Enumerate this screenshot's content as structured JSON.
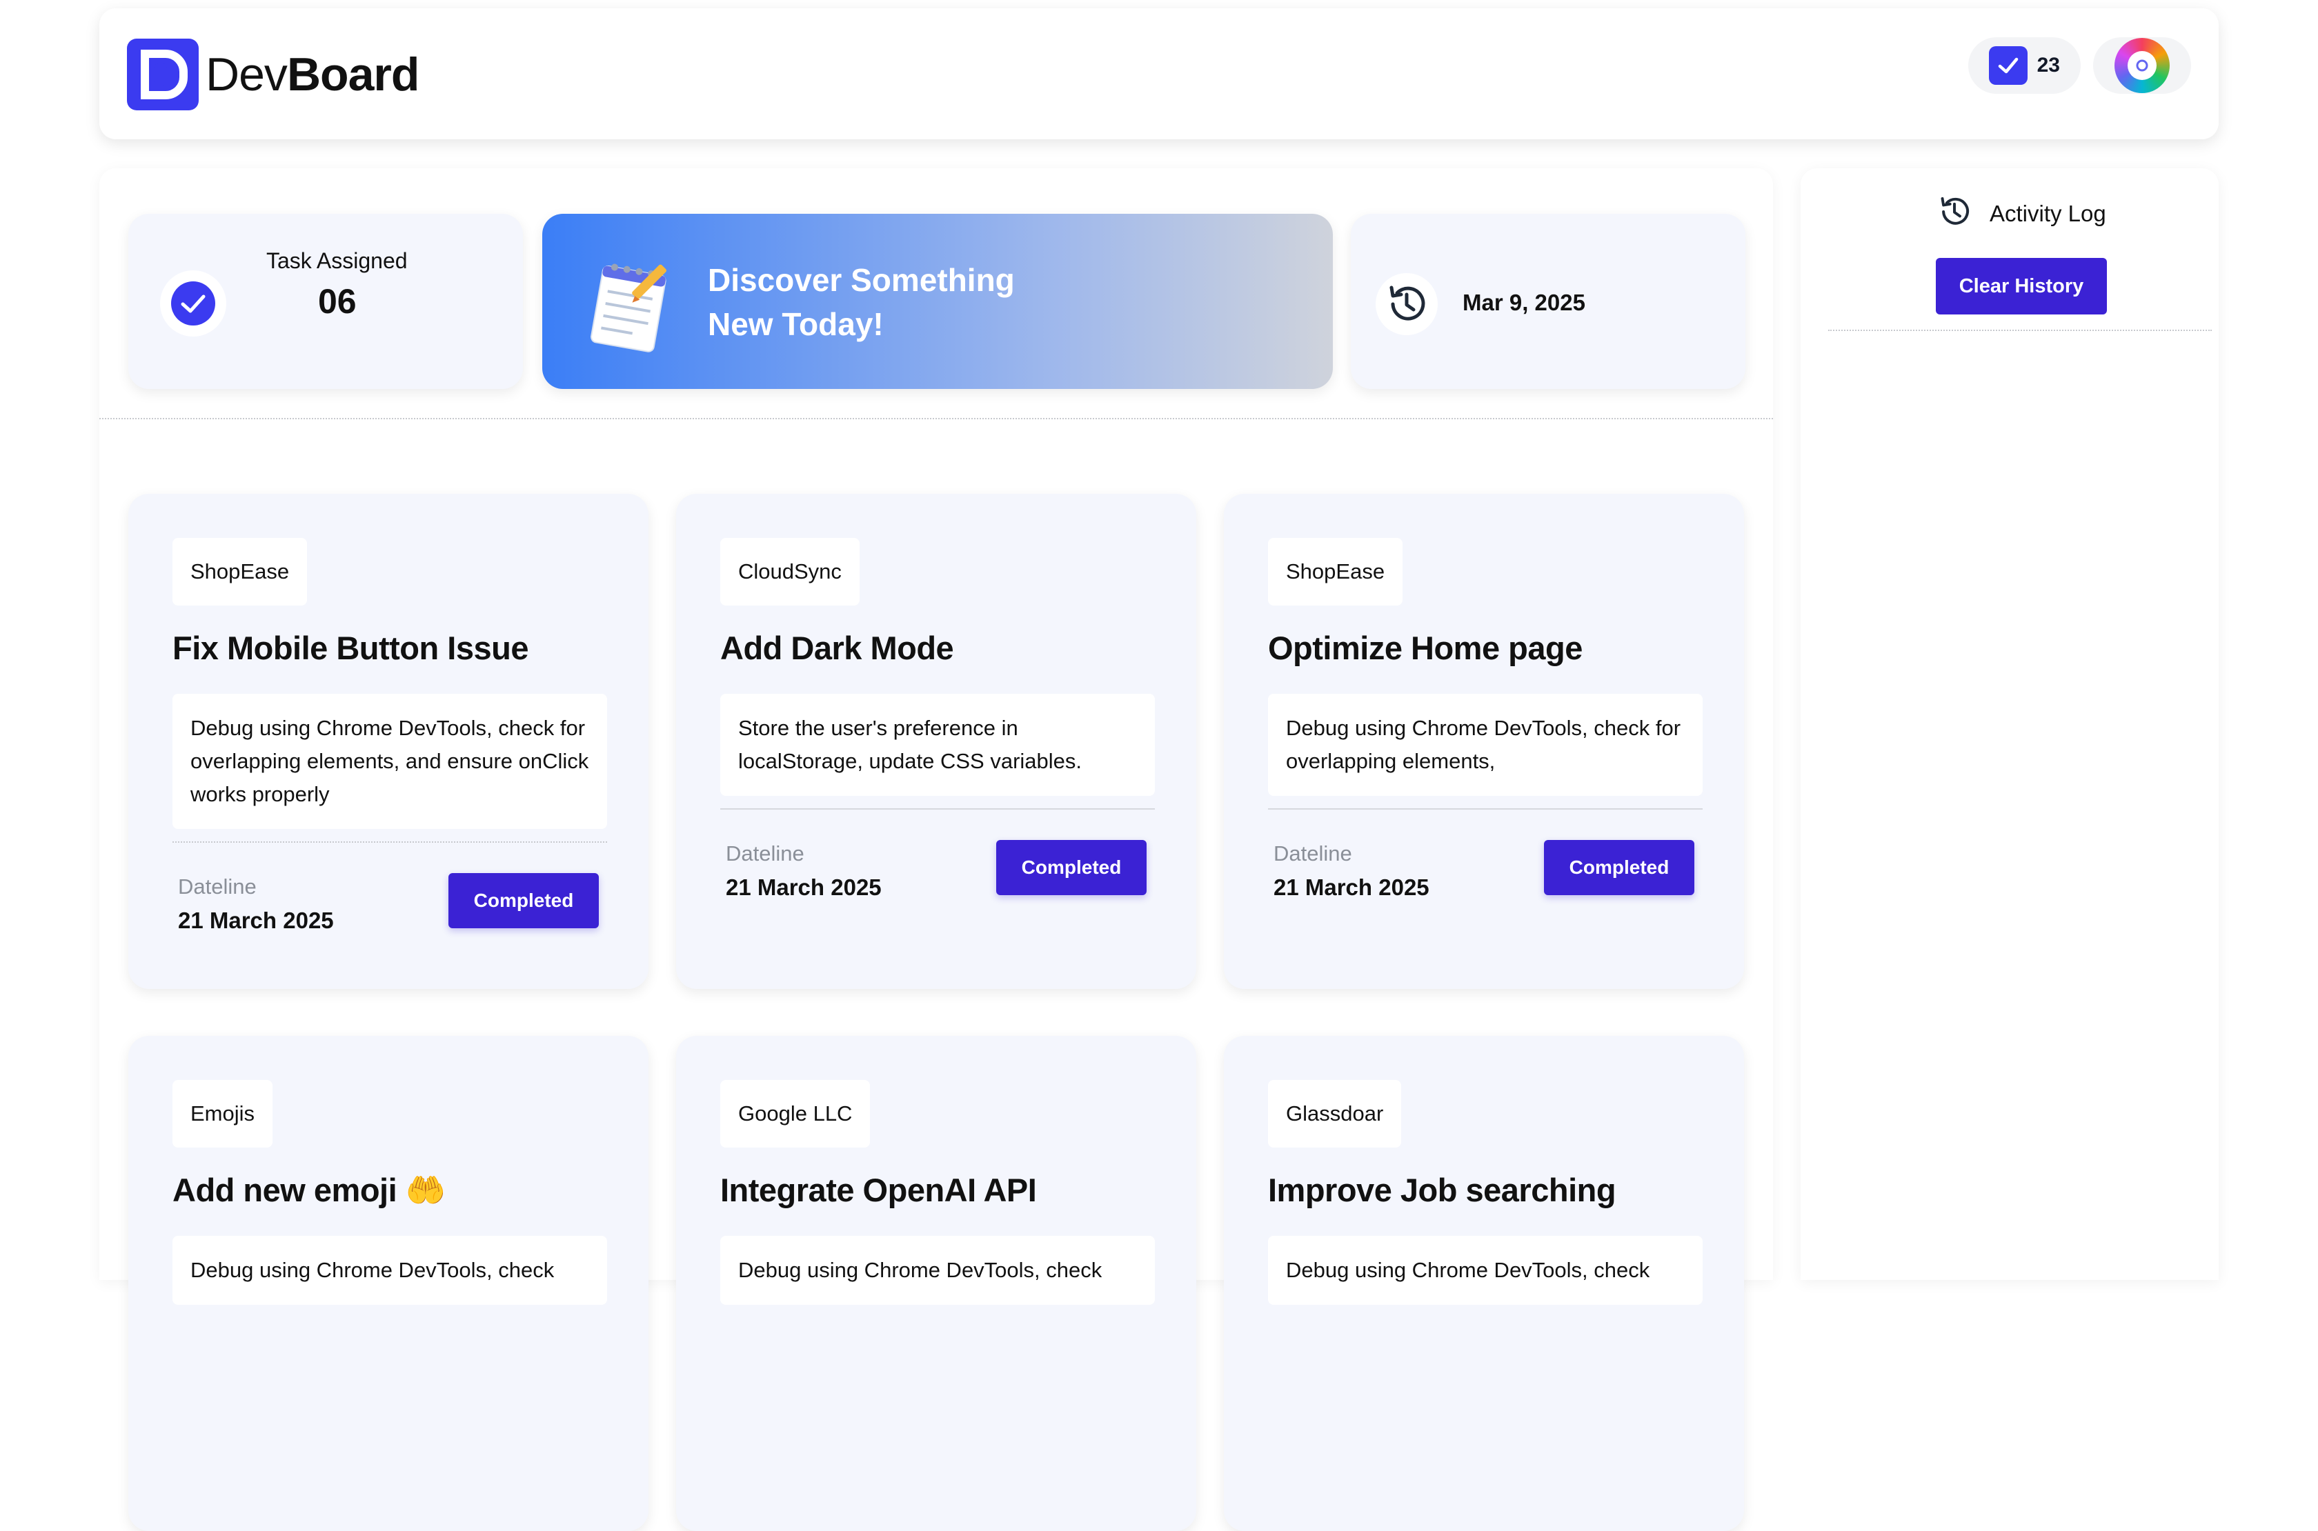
{
  "brand": {
    "prefix": "Dev",
    "bold": "Board"
  },
  "header": {
    "task_count": "23"
  },
  "stats": {
    "task_assigned_label": "Task Assigned",
    "task_assigned_value": "06",
    "banner_line1": "Discover Something",
    "banner_line2": "New Today!",
    "date": "Mar 9, 2025"
  },
  "tasks": [
    {
      "tag": "ShopEase",
      "title": "Fix Mobile Button Issue",
      "description": "Debug using Chrome DevTools, check for overlapping elements, and ensure onClick works properly",
      "deadline_label": "Dateline",
      "deadline": "21 March 2025",
      "button": "Completed"
    },
    {
      "tag": "CloudSync",
      "title": "Add Dark Mode",
      "description": "Store the user's preference in localStorage, update CSS variables.",
      "deadline_label": "Dateline",
      "deadline": "21 March 2025",
      "button": "Completed"
    },
    {
      "tag": "ShopEase",
      "title": "Optimize Home page",
      "description": "Debug using Chrome DevTools, check for overlapping elements,",
      "deadline_label": "Dateline",
      "deadline": "21 March 2025",
      "button": "Completed"
    },
    {
      "tag": "Emojis",
      "title": "Add new emoji 🤲",
      "description": "Debug using Chrome DevTools, check"
    },
    {
      "tag": "Google LLC",
      "title": "Integrate OpenAI API",
      "description": "Debug using Chrome DevTools, check"
    },
    {
      "tag": "Glassdoar",
      "title": "Improve Job searching",
      "description": "Debug using Chrome DevTools, check"
    }
  ],
  "sidebar": {
    "title": "Activity Log",
    "clear_button": "Clear History"
  },
  "colors": {
    "primary": "#3b22d4",
    "logo": "#3b3bf0",
    "card_bg": "#f4f6fd",
    "banner_start": "#3b7ef6",
    "banner_end": "#cfd3dc"
  }
}
